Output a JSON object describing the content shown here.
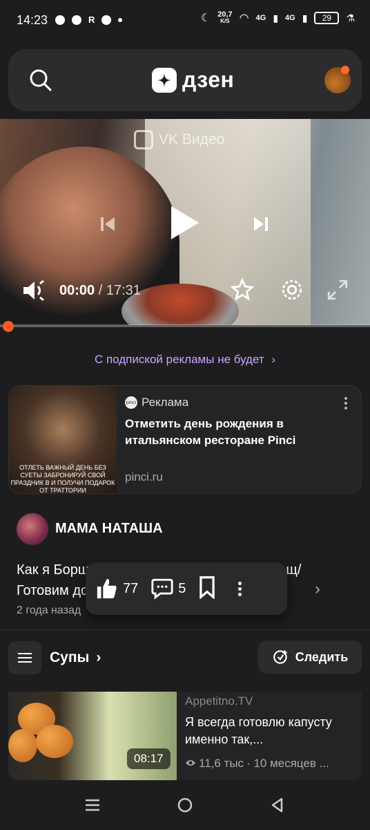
{
  "status_bar": {
    "time": "14:23",
    "network_speed": "20,7",
    "network_unit": "K/S",
    "signal1": "4G",
    "signal2": "4G",
    "battery": "29"
  },
  "header": {
    "logo_text": "дзен"
  },
  "video": {
    "watermark": "VK Видео",
    "current_time": "00:00",
    "duration": "/ 17:31",
    "progress": 0.0
  },
  "promo_link": "С подпиской рекламы не будет",
  "ad": {
    "label": "Реклама",
    "logo_text": "pinci",
    "title": "Отметить день рождения в итальянском ресторане Pinci",
    "url": "pinci.ru",
    "image_text": "ОТЛЕТЬ ВАЖНЫЙ ДЕНЬ БЕЗ СУЕТЫ ЗАБРОНИРУЙ СВОЙ ПРАЗДНИК В И ПОЛУЧИ ПОДАРОК ОТ ТРАТТОРИИ"
  },
  "post": {
    "channel": "МАМА НАТАША",
    "title": "Как я Борщ готовлю / Как приготовить борщ/Готовим дома/...",
    "date": "2 года назад"
  },
  "actions": {
    "likes": "77",
    "comments": "5"
  },
  "topic_bar": {
    "topic": "Супы",
    "follow_label": "Следить"
  },
  "related": {
    "source": "Appetitno.TV",
    "title": "Я всегда готовлю капусту именно так,...",
    "duration": "08:17",
    "views": "11,6 тыс",
    "age": "· 10 месяцев ..."
  },
  "colors": {
    "background": "#1d1d1f",
    "accent_link": "#c9a6ff",
    "progress": "#ff5a1f"
  }
}
